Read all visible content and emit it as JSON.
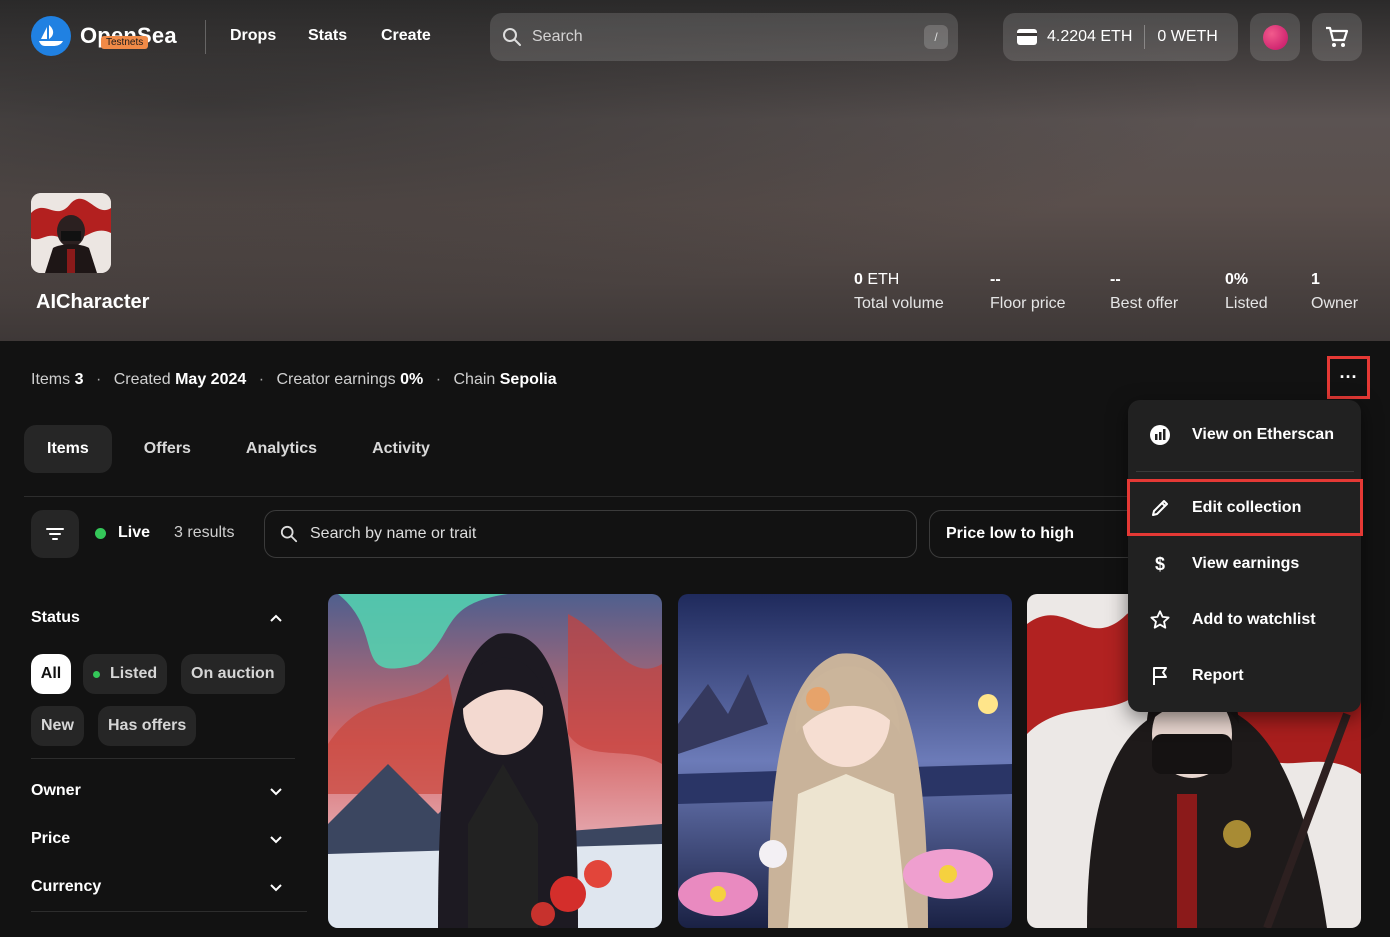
{
  "nav": {
    "logo": "OpenSea",
    "badge": "Testnets",
    "links": [
      "Drops",
      "Stats",
      "Create"
    ],
    "search_placeholder": "Search",
    "search_shortcut": "/",
    "wallet_eth": "4.2204 ETH",
    "wallet_weth": "0 WETH"
  },
  "collection": {
    "name": "AICharacter",
    "stats": [
      {
        "value": "0",
        "unit": " ETH",
        "label": "Total volume"
      },
      {
        "value": "--",
        "unit": "",
        "label": "Floor price"
      },
      {
        "value": "--",
        "unit": "",
        "label": "Best offer"
      },
      {
        "value": "0%",
        "unit": "",
        "label": "Listed"
      },
      {
        "value": "1",
        "unit": "",
        "label": "Owner"
      }
    ]
  },
  "meta": {
    "items_label": "Items",
    "items_value": "3",
    "created_label": "Created",
    "created_value": "May 2024",
    "earnings_label": "Creator earnings",
    "earnings_value": "0%",
    "chain_label": "Chain",
    "chain_value": "Sepolia",
    "more": "···"
  },
  "tabs": [
    "Items",
    "Offers",
    "Analytics",
    "Activity"
  ],
  "filters": {
    "live": "Live",
    "results": "3 results",
    "search_placeholder": "Search by name or trait",
    "sort": "Price low to high"
  },
  "sidebar": {
    "status": "Status",
    "chips": [
      "All",
      "Listed",
      "On auction",
      "New",
      "Has offers"
    ],
    "owner": "Owner",
    "price": "Price",
    "currency": "Currency"
  },
  "menu": {
    "items": [
      "View on Etherscan",
      "Edit collection",
      "View earnings",
      "Add to watchlist",
      "Report"
    ]
  },
  "colors": {
    "accent": "#2081e2",
    "highlight": "#e53935",
    "live": "#34c759"
  }
}
